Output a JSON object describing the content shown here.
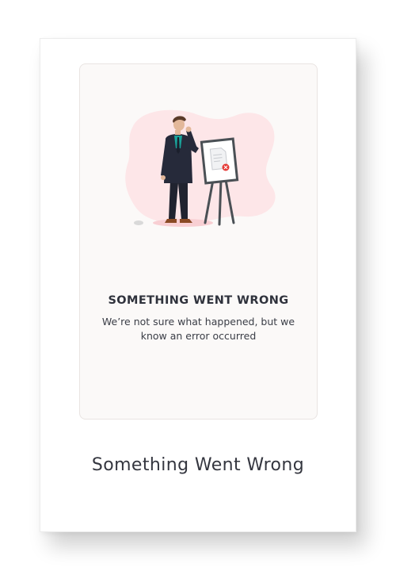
{
  "error_panel": {
    "heading": "SOMETHING WENT WRONG",
    "description": "We’re not sure what happened, but we know an error occurred",
    "illustration": "confused-man-at-easel-illustration",
    "error_badge_icon": "close-icon"
  },
  "card": {
    "title": "Something Went Wrong"
  },
  "colors": {
    "blob": "#fde6e8",
    "error_red": "#e53935",
    "suit": "#262a3a",
    "tie": "#1aa39a",
    "easel": "#4a5055"
  }
}
